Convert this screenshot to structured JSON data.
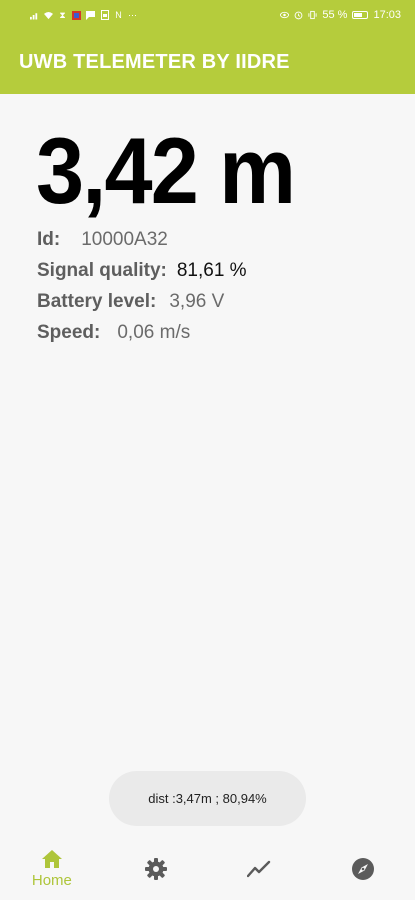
{
  "status_bar": {
    "left_icons": [
      "signal-icon",
      "wifi-icon",
      "hourglass-icon",
      "app-icon",
      "message-icon",
      "sim-icon",
      "n-icon",
      "more-icon"
    ],
    "battery_percent": "55 %",
    "time": "17:03"
  },
  "app_bar": {
    "title": "UWB TELEMETER BY IIDRE"
  },
  "main": {
    "distance": "3,42 m",
    "id_label": "Id:",
    "id_value": "10000A32",
    "signal_label": "Signal quality:",
    "signal_value": "81,61 %",
    "battery_label": "Battery level:",
    "battery_value": "3,96 V",
    "speed_label": "Speed:",
    "speed_value": "0,06 m/s"
  },
  "toast": {
    "text": "dist :3,47m ; 80,94%"
  },
  "bottom_nav": {
    "home_label": "Home",
    "items": [
      "home-icon",
      "settings-icon",
      "chart-icon",
      "compass-icon"
    ]
  },
  "colors": {
    "accent": "#b5cc3c",
    "nav_active": "#aec53a",
    "nav_inactive": "#5b5b5b"
  }
}
